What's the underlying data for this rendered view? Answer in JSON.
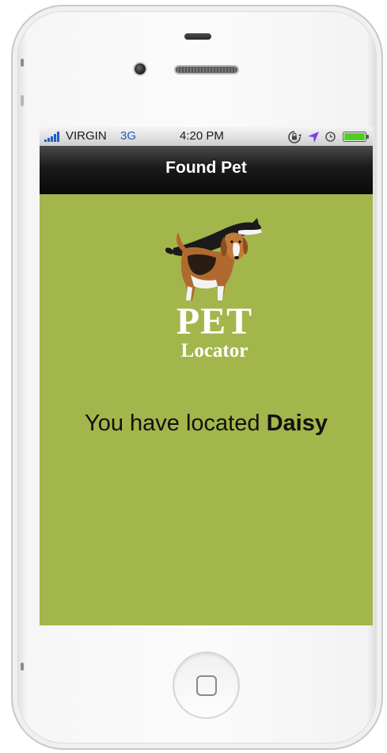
{
  "status_bar": {
    "carrier": "VIRGIN",
    "network": "3G",
    "time": "4:20 PM",
    "icons": [
      "signal-icon",
      "orientation-lock-icon",
      "location-arrow-icon",
      "alarm-icon",
      "battery-icon"
    ]
  },
  "nav_bar": {
    "title": "Found Pet"
  },
  "logo": {
    "line1": "PET",
    "line2": "Locator",
    "image": "dog-and-cat-icon"
  },
  "message": {
    "prefix": "You have located ",
    "pet_name": "Daisy"
  },
  "colors": {
    "screen_background": "#a2b64b",
    "nav_bar": "#1a1a1a",
    "network_label": "#1f5fc4",
    "battery": "#4fd021"
  },
  "device": {
    "icons": [
      "home-button-icon",
      "camera-icon",
      "earpiece-icon"
    ]
  }
}
